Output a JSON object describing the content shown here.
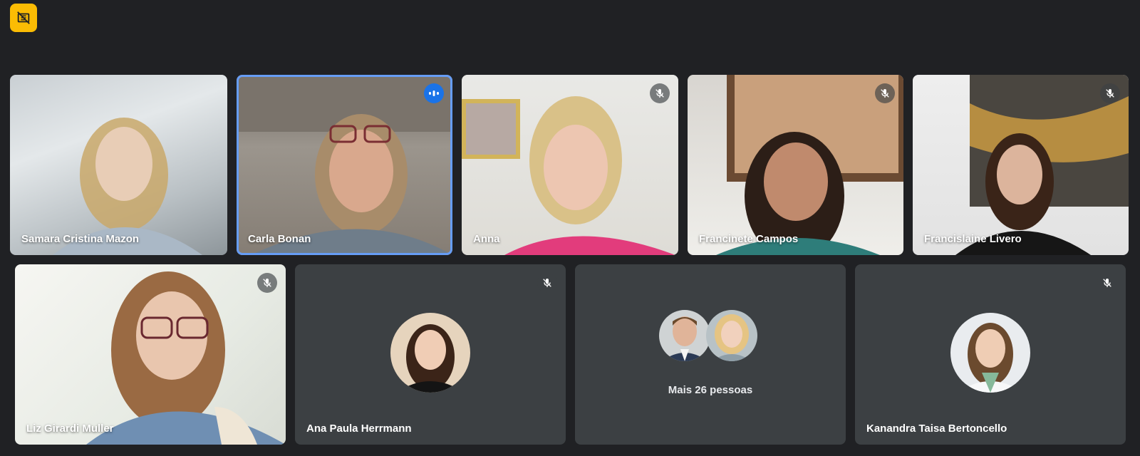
{
  "recording_badge": {
    "icon": "recording-off-icon",
    "color": "#fbbc04"
  },
  "participants": {
    "row1": [
      {
        "name": "Samara Cristina Mazon",
        "mic": "unmuted"
      },
      {
        "name": "Carla Bonan",
        "mic": "speaking"
      },
      {
        "name": "Anna",
        "mic": "muted"
      },
      {
        "name": "Francinete Campos",
        "mic": "muted"
      },
      {
        "name": "Francislaine Livero",
        "mic": "muted"
      }
    ],
    "row2": [
      {
        "name": "Liz Girardi Muller",
        "mic": "muted"
      },
      {
        "name": "Ana Paula Herrmann",
        "mic": "muted"
      },
      {
        "name": "",
        "mic": "none"
      },
      {
        "name": "Kanandra Taisa Bertoncello",
        "mic": "muted"
      }
    ]
  },
  "more_people": {
    "label": "Mais 26 pessoas"
  },
  "colors": {
    "background": "#202124",
    "tile": "#3c4043",
    "speaking_border": "#669df6",
    "speaking_indicator": "#1a73e8"
  }
}
